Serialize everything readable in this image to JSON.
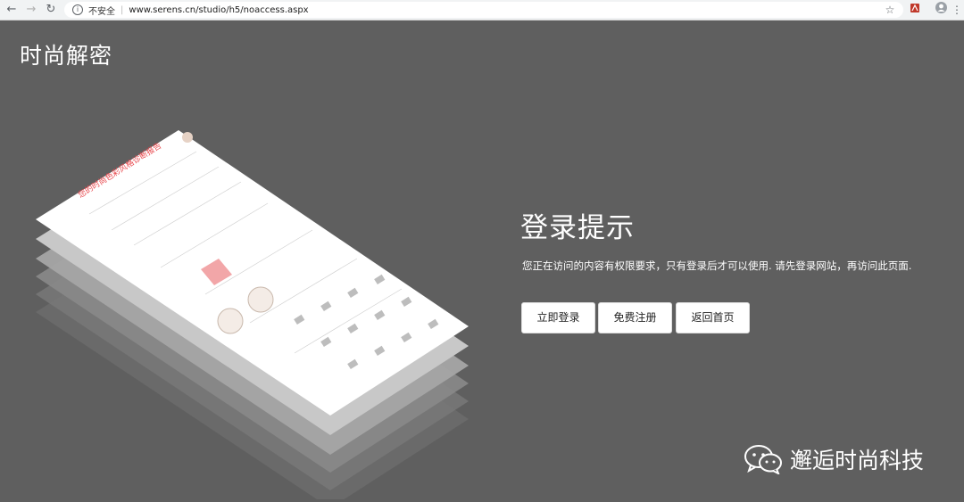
{
  "browser": {
    "security_label": "不安全",
    "url": "www.serens.cn/studio/h5/noaccess.aspx"
  },
  "logo": {
    "text": "时尚解密"
  },
  "notice": {
    "title": "登录提示",
    "description": "您正在访问的内容有权限要求，只有登录后才可以使用. 请先登录网站，再访问此页面."
  },
  "buttons": {
    "login": "立即登录",
    "register": "免费注册",
    "home": "返回首页"
  },
  "watermark": {
    "text": "邂逅时尚科技"
  },
  "illustration": {
    "report_title": "您的时尚色彩风格诊断报告"
  },
  "colors": {
    "background": "#5f5f5f",
    "accent": "#e8474c"
  }
}
